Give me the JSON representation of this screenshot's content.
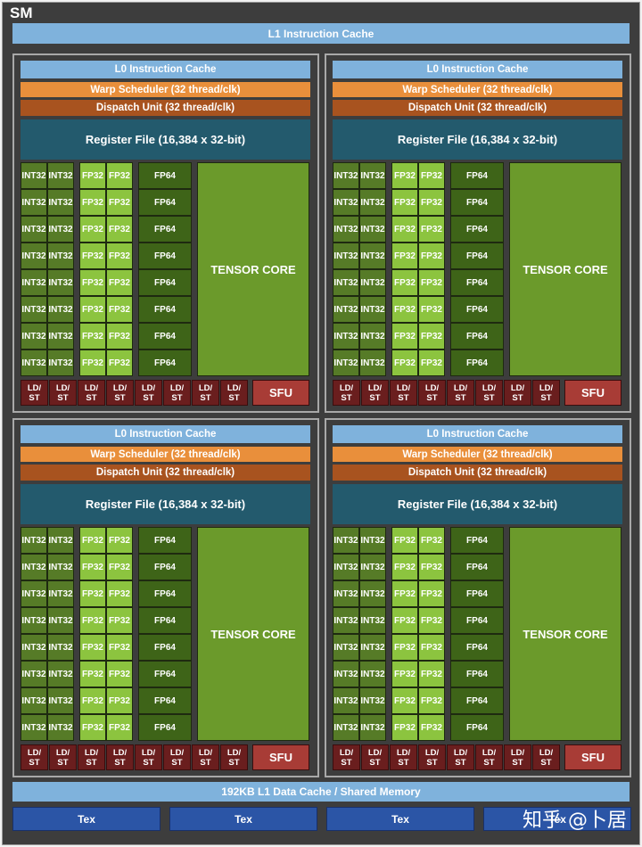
{
  "title": "SM",
  "l1_instruction_cache": "L1 Instruction Cache",
  "quadrant": {
    "l0_cache": "L0 Instruction Cache",
    "warp_scheduler": "Warp Scheduler (32 thread/clk)",
    "dispatch_unit": "Dispatch Unit (32 thread/clk)",
    "register_file": "Register File (16,384 x 32-bit)",
    "int32": "INT32",
    "fp32": "FP32",
    "fp64": "FP64",
    "tensor_core": "TENSOR CORE",
    "ldst": "LD/\nST",
    "sfu": "SFU",
    "rows": 8,
    "ldst_count": 8
  },
  "quadrant_count": 4,
  "l1_data_cache": "192KB L1 Data Cache / Shared Memory",
  "tex_units": [
    "Tex",
    "Tex",
    "Tex",
    "Tex"
  ],
  "watermark": "知乎 @卜居",
  "colors": {
    "light_blue": "#7fb2dc",
    "orange": "#e98f3b",
    "brown": "#a8531f",
    "register": "#235a6d",
    "int32": "#567b27",
    "fp32": "#8cc43f",
    "fp64": "#3e6418",
    "tensor": "#6b9a2b",
    "ldst": "#6a1e1e",
    "sfu": "#a83c36",
    "tex": "#2b55a6"
  }
}
